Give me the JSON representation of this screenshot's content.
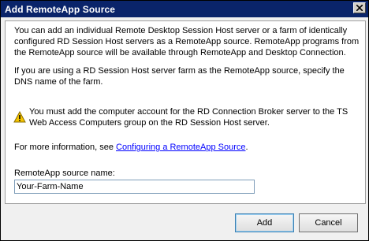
{
  "dialog": {
    "title": "Add RemoteApp Source",
    "intro_text": "You can add an individual Remote Desktop Session Host server or a farm of identically configured RD Session Host servers as a RemoteApp source. RemoteApp programs from the RemoteApp source will be available through RemoteApp and Desktop Connection.",
    "farm_text": "If you are using a RD Session Host server farm as the RemoteApp source, specify the DNS name of the farm.",
    "warning_text": "You must add the computer account for the RD Connection Broker server to the TS Web Access Computers group on the RD Session Host server.",
    "info_prefix": "For more information, see ",
    "info_link": "Configuring a RemoteApp Source",
    "info_suffix": ".",
    "source_name_label": "RemoteApp source name:",
    "source_name_value": "Your-Farm-Name",
    "add_label": "Add",
    "cancel_label": "Cancel"
  },
  "icons": {
    "close": "close-icon",
    "warning": "warning-icon"
  },
  "colors": {
    "titlebar": "#0a246a",
    "link": "#0000ff",
    "warning_fill": "#f5c400"
  }
}
